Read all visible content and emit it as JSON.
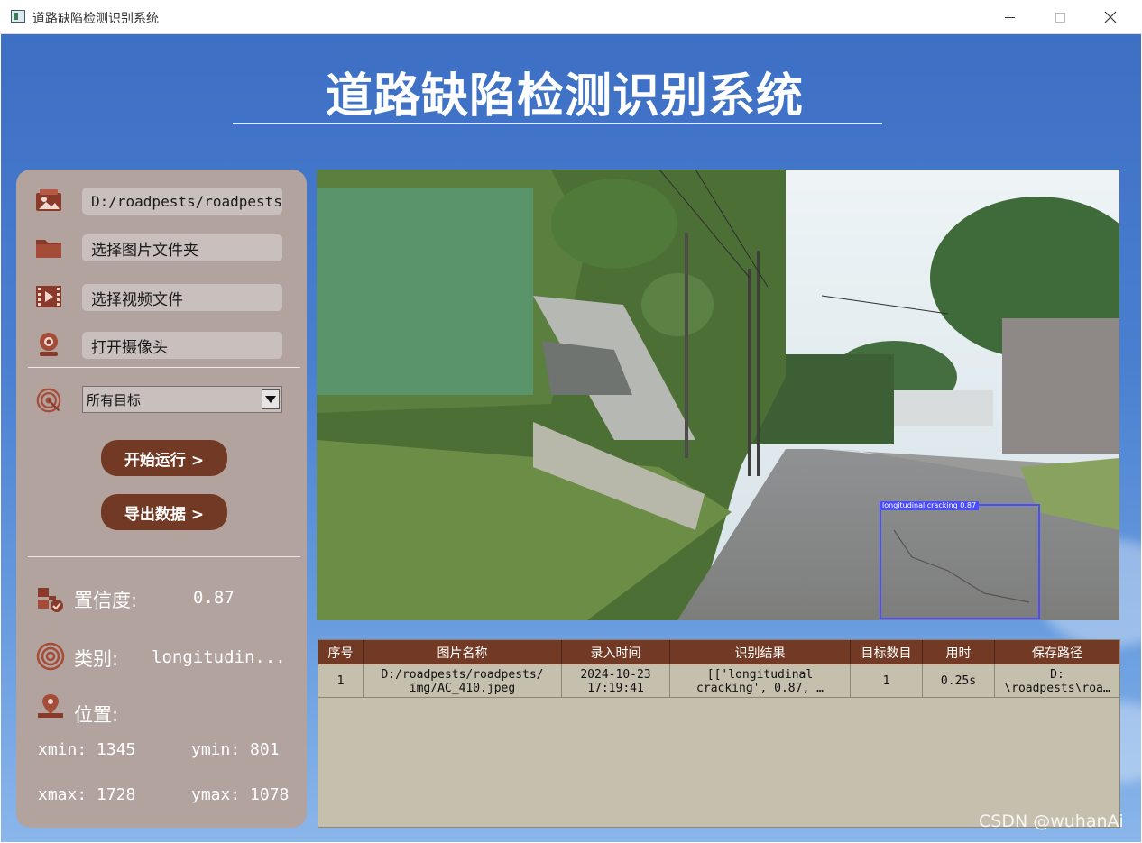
{
  "window": {
    "title": "道路缺陷检测识别系统"
  },
  "app": {
    "heading": "道路缺陷检测识别系统"
  },
  "sidebar": {
    "image_path": "D:/roadpests/roadpests/i",
    "select_folder_label": "选择图片文件夹",
    "select_video_label": "选择视频文件",
    "open_camera_label": "打开摄像头",
    "target_select_value": "所有目标",
    "start_button": "开始运行 >",
    "export_button": "导出数据 >",
    "confidence_label": "置信度:",
    "confidence_value": "0.87",
    "class_label": "类别:",
    "class_value": "longitudin...",
    "position_label": "位置:",
    "xmin": "xmin: 1345",
    "ymin": "ymin: 801",
    "xmax": "xmax: 1728",
    "ymax": "ymax: 1078"
  },
  "detection": {
    "label": "longitudinal cracking 0.87",
    "box_color": "#4b4bff"
  },
  "table": {
    "headers": [
      "序号",
      "图片名称",
      "录入时间",
      "识别结果",
      "目标数目",
      "用时",
      "保存路径"
    ],
    "rows": [
      [
        "1",
        "D:/roadpests/roadpests/\nimg/AC_410.jpeg",
        "2024-10-23\n17:19:41",
        "[['longitudinal\ncracking', 0.87, …",
        "1",
        "0.25s",
        "D:\n\\roadpests\\roa…"
      ]
    ]
  },
  "watermark": "CSDN @wuhanAi",
  "colors": {
    "accent_brown": "#723a24",
    "panel": "#b3a39e",
    "table_bg": "#c5bfae"
  },
  "icons": {
    "image": "image-icon",
    "folder": "folder-icon",
    "video": "video-icon",
    "camera": "camera-icon",
    "target": "target-icon",
    "confidence": "confidence-icon",
    "class": "class-icon",
    "location": "location-pin-icon"
  }
}
